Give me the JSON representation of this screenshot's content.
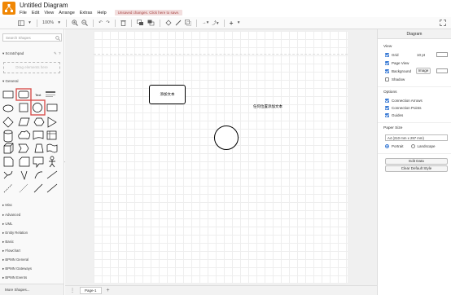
{
  "window": {
    "title": "Untitled Diagram"
  },
  "menu": {
    "items": [
      "File",
      "Edit",
      "View",
      "Arrange",
      "Extras",
      "Help"
    ],
    "unsaved_notice": "Unsaved changes. Click here to save."
  },
  "toolbar": {
    "zoom": "100%"
  },
  "sidebar": {
    "search_placeholder": "Search Shapes",
    "scratchpad_title": "Scratchpad",
    "drag_hint": "Drag elements here",
    "general_title": "General",
    "text_shape_label": "Text",
    "categories": [
      "Misc",
      "Advanced",
      "UML",
      "Entity Relation",
      "Basic",
      "Flowchart",
      "BPMN General",
      "BPMN Gateways",
      "BPMN Events"
    ],
    "more_shapes": "More Shapes..."
  },
  "canvas": {
    "rect_text": "添加文本",
    "free_text": "任何位置添加文本"
  },
  "bottombar": {
    "page_tab": "Page-1",
    "add_page": "+"
  },
  "rightpanel": {
    "header": "Diagram",
    "view_title": "View",
    "grid_label": "Grid",
    "grid_size": "10 pt",
    "page_view_label": "Page View",
    "background_label": "Background",
    "image_button": "Image",
    "shadow_label": "Shadow",
    "options_title": "Options",
    "connection_arrows_label": "Connection Arrows",
    "connection_points_label": "Connection Points",
    "guides_label": "Guides",
    "paper_size_title": "Paper Size",
    "paper_size_value": "A4 (210 mm x 297 mm)",
    "portrait_label": "Portrait",
    "landscape_label": "Landscape",
    "edit_data_button": "Edit Data",
    "clear_default_style_button": "Clear Default Style"
  },
  "colors": {
    "logo": "#f08705",
    "checkbox": "#3a7bd5",
    "selection": "#d9534f"
  }
}
